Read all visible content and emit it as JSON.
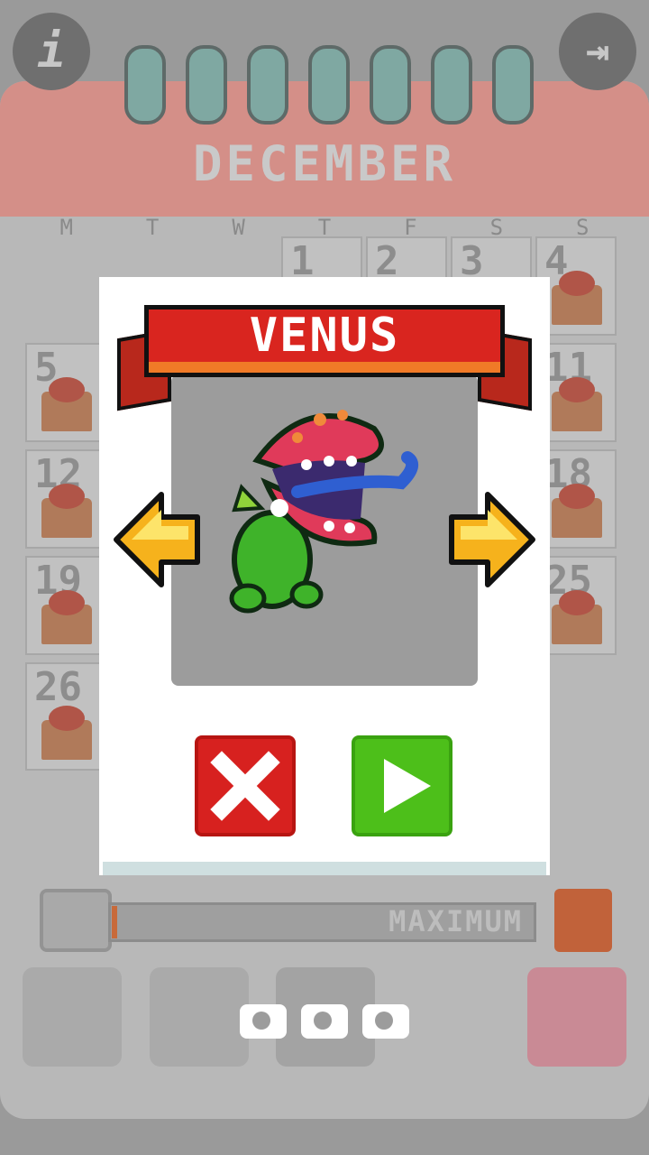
{
  "calendar": {
    "month": "DECEMBER",
    "weekdays": [
      "M",
      "T",
      "W",
      "T",
      "F",
      "S",
      "S"
    ],
    "rows": [
      [
        "",
        "",
        "",
        "1",
        "2",
        "3",
        "4"
      ],
      [
        "5",
        "",
        "",
        "",
        "",
        "",
        "11"
      ],
      [
        "12",
        "",
        "",
        "",
        "",
        "",
        "18"
      ],
      [
        "19",
        "",
        "",
        "",
        "",
        "",
        "25"
      ],
      [
        "26",
        "",
        "",
        "",
        "",
        "",
        ""
      ]
    ],
    "info_icon": "info-icon",
    "exit_icon": "exit-icon"
  },
  "progress": {
    "label": "MAXIMUM",
    "trophy_icon": "trophy-icon",
    "gift_icon": "gift-icon"
  },
  "bottom_tabs": [
    "profile-icon",
    "gamepad-icon",
    "bunny-character-icon",
    "pink-face-icon"
  ],
  "modal": {
    "title": "VENUS",
    "character": "venus-flytrap-character",
    "camera_slots": 3,
    "prev_icon": "arrow-left-icon",
    "next_icon": "arrow-right-icon",
    "cancel_icon": "close-icon",
    "play_icon": "play-icon",
    "colors": {
      "ribbon": "#d9251f",
      "cancel": "#d7211f",
      "play": "#4dbf1a",
      "arrow": "#f6b21c"
    }
  }
}
